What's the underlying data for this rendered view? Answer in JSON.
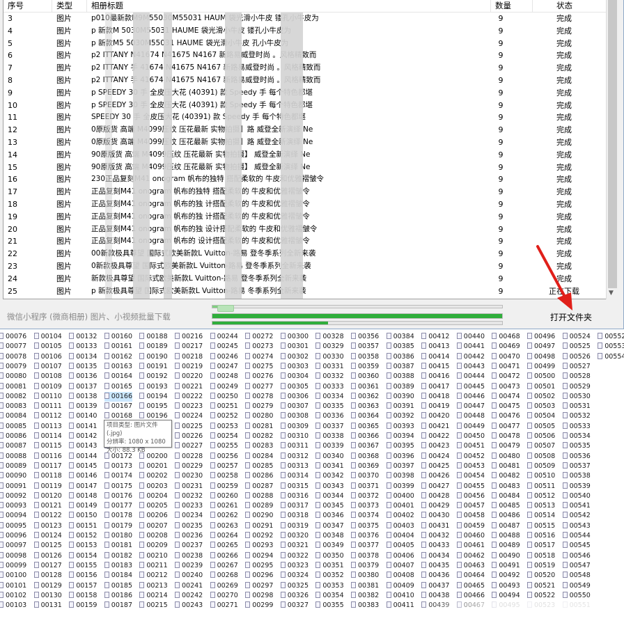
{
  "columns": {
    "num": "序号",
    "type": "类型",
    "title": "相册标题",
    "qty": "数量",
    "status": "状态"
  },
  "rows": [
    {
      "num": "3",
      "type": "图片",
      "title": "p010最新款M9M55030M55031 HAUM 袋光滑小牛皮 镂孔小牛皮为",
      "qty": "9",
      "status": "完成"
    },
    {
      "num": "4",
      "type": "图片",
      "title": "p 新款M 5030M55031 HAUME 袋光滑小牛皮 镂孔小牛皮为",
      "qty": "9",
      "status": "完成"
    },
    {
      "num": "5",
      "type": "图片",
      "title": "p 新款M5 5030M55031 HAUME 袋光滑小牛皮 孔小牛皮为",
      "qty": "9",
      "status": "完成"
    },
    {
      "num": "6",
      "type": "图片",
      "title": "p2 ITTANY N41674 N41675 N4167 新路易威登时尚 。风格精致而",
      "qty": "9",
      "status": "完成"
    },
    {
      "num": "7",
      "type": "图片",
      "title": "p2 ITTANY 手 41674 N41675 N4167 新路易威登时尚 。风格精致而",
      "qty": "9",
      "status": "完成"
    },
    {
      "num": "8",
      "type": "图片",
      "title": "p2 ITTANY 手 41674 N41675 N4167 新路易威登时尚 。风格精致而",
      "qty": "9",
      "status": "完成"
    },
    {
      "num": "9",
      "type": "图片",
      "title": "p SPEEDY 30 手 全皮压大花 (40391) 款 Speedy 手 每个特色都堪",
      "qty": "9",
      "status": "完成"
    },
    {
      "num": "10",
      "type": "图片",
      "title": "p SPEEDY 30 手 全皮压大花 (40391) 款 Speedy 手 每个特色都堪",
      "qty": "9",
      "status": "完成"
    },
    {
      "num": "11",
      "type": "图片",
      "title": "SPEEDY 30 手 全皮压大花 (40391) 款 Speedy 手 每个特色都堪",
      "qty": "9",
      "status": "完成"
    },
    {
      "num": "12",
      "type": "图片",
      "title": "0原版货 高端 M4099压纹 压花最新 实物拍摄】路 威登全新演绎 Ne",
      "qty": "9",
      "status": "完成"
    },
    {
      "num": "13",
      "type": "图片",
      "title": "0原版货 高端 M4099压纹 压花最新 实物拍摄】路 威登全新演绎 Ne",
      "qty": "9",
      "status": "完成"
    },
    {
      "num": "14",
      "type": "图片",
      "title": "90原版货 高端 M4099压纹 压花最新 实物拍摄】 威登全新演绎 Ne",
      "qty": "9",
      "status": "完成"
    },
    {
      "num": "15",
      "type": "图片",
      "title": "90原版货 高端 M4099压纹 压花最新 实物拍摄】 威登全新演绎 Ne",
      "qty": "9",
      "status": "完成"
    },
    {
      "num": "16",
      "type": "图片",
      "title": "230正品复刻M41 onogram 帆布的独特 搭配柔软的 牛皮和优雅褶皱令",
      "qty": "9",
      "status": "完成"
    },
    {
      "num": "17",
      "type": "图片",
      "title": "正品复刻M41 onogram 帆布的独特 搭配柔软的 牛皮和优雅褶皱令",
      "qty": "9",
      "status": "完成"
    },
    {
      "num": "18",
      "type": "图片",
      "title": "正品复刻M41 onogram 帆布的独 计搭配柔软的 牛皮和优雅褶皱令",
      "qty": "9",
      "status": "完成"
    },
    {
      "num": "19",
      "type": "图片",
      "title": "正品复刻M41 onogram 帆布的独 计搭配柔软的 牛皮和优雅褶皱令",
      "qty": "9",
      "status": "完成"
    },
    {
      "num": "20",
      "type": "图片",
      "title": "正品复刻M41 onogram 帆布的独 设计搭配柔软的 牛皮和优雅褶皱令",
      "qty": "9",
      "status": "完成"
    },
    {
      "num": "21",
      "type": "图片",
      "title": "正品复刻M41 onogram 帆布的 设计搭配柔软的 牛皮和优雅褶皱令",
      "qty": "9",
      "status": "完成"
    },
    {
      "num": "22",
      "type": "图片",
      "title": "00新款极具尊望 国际式欧美新款L Vuitton-路易 登冬季系列全新来袭",
      "qty": "9",
      "status": "完成"
    },
    {
      "num": "23",
      "type": "图片",
      "title": "0新款极具尊望 国际式欧美新款L Vuitton-路易 登冬季系列全新来袭",
      "qty": "9",
      "status": "完成"
    },
    {
      "num": "24",
      "type": "图片",
      "title": "新款极具尊望 国际式欧美新款L Vuitton-路易 登冬季系列全新来袭",
      "qty": "9",
      "status": "完成"
    },
    {
      "num": "25",
      "type": "图片",
      "title": "p 新款极具尊望 国际式欧美新款L Vuitton-路易 冬季系列全新来袭",
      "qty": "9",
      "status": "正在下载"
    }
  ],
  "bottom": {
    "hint": "微信小程序 (微商相册) 图片、小视频批量下载",
    "open_folder_label": "打开文件夹",
    "progress_top": 0.05,
    "progress_middle": 1.0,
    "progress_bottom": 0.4
  },
  "tooltip": {
    "line1": "项目类型: 图片文件(.jpg)",
    "line2": "分辨率: 1080 x 1080",
    "line3": "大小: 88.3 KB"
  },
  "files": {
    "columns": [
      [
        "00076",
        "00077",
        "00078",
        "00079",
        "00080",
        "00081",
        "00082",
        "00083",
        "00084",
        "00085",
        "00086",
        "00087",
        "00088",
        "00089",
        "00090",
        "00091",
        "00092",
        "00093",
        "00094",
        "00095",
        "00096",
        "00097",
        "00098",
        "00099",
        "00100",
        "00101",
        "00102",
        "00103"
      ],
      [
        "00104",
        "00105",
        "00106",
        "00107",
        "00108",
        "00109",
        "00110",
        "00111",
        "00112",
        "00113",
        "00114",
        "00115",
        "00116",
        "00117",
        "00118",
        "00119",
        "00120",
        "00121",
        "00122",
        "00123",
        "00124",
        "00125",
        "00126",
        "00127",
        "00128",
        "00129",
        "00130",
        "00131"
      ],
      [
        "00132",
        "00133",
        "00134",
        "00135",
        "00136",
        "00137",
        "00138",
        "00139",
        "00140",
        "00141",
        "00142",
        "00143",
        "00144",
        "00145",
        "00146",
        "00147",
        "00148",
        "00149",
        "00150",
        "00151",
        "00152",
        "00153",
        "00154",
        "00155",
        "00156",
        "00157",
        "00158",
        "00159"
      ],
      [
        "00160",
        "00161",
        "00162",
        "00163",
        "00164",
        "00165",
        "00166",
        "00167",
        "00168",
        "00169",
        "00170",
        "00171",
        "00172",
        "00173",
        "00174",
        "00175",
        "00176",
        "00177",
        "00178",
        "00179",
        "00180",
        "00181",
        "00182",
        "00183",
        "00184",
        "00185",
        "00186",
        "00187"
      ],
      [
        "00188",
        "00189",
        "00190",
        "00191",
        "00192",
        "00193",
        "00194",
        "00195",
        "00196",
        "00197",
        "00198",
        "00199",
        "00200",
        "00201",
        "00202",
        "00203",
        "00204",
        "00205",
        "00206",
        "00207",
        "00208",
        "00209",
        "00210",
        "00211",
        "00212",
        "00213",
        "00214",
        "00215"
      ],
      [
        "00216",
        "00217",
        "00218",
        "00219",
        "00220",
        "00221",
        "00222",
        "00223",
        "00224",
        "00225",
        "00226",
        "00227",
        "00228",
        "00229",
        "00230",
        "00231",
        "00232",
        "00233",
        "00234",
        "00235",
        "00236",
        "00237",
        "00238",
        "00239",
        "00240",
        "00241",
        "00242",
        "00243"
      ],
      [
        "00244",
        "00245",
        "00246",
        "00247",
        "00248",
        "00249",
        "00250",
        "00251",
        "00252",
        "00253",
        "00254",
        "00255",
        "00256",
        "00257",
        "00258",
        "00259",
        "00260",
        "00261",
        "00262",
        "00263",
        "00264",
        "00265",
        "00266",
        "00267",
        "00268",
        "00269",
        "00270",
        "00271"
      ],
      [
        "00272",
        "00273",
        "00274",
        "00275",
        "00276",
        "00277",
        "00278",
        "00279",
        "00280",
        "00281",
        "00282",
        "00283",
        "00284",
        "00285",
        "00286",
        "00287",
        "00288",
        "00289",
        "00290",
        "00291",
        "00292",
        "00293",
        "00294",
        "00295",
        "00296",
        "00297",
        "00298",
        "00299"
      ],
      [
        "00300",
        "00301",
        "00302",
        "00303",
        "00304",
        "00305",
        "00306",
        "00307",
        "00308",
        "00309",
        "00310",
        "00311",
        "00312",
        "00313",
        "00314",
        "00315",
        "00316",
        "00317",
        "00318",
        "00319",
        "00320",
        "00321",
        "00322",
        "00323",
        "00324",
        "00325",
        "00326",
        "00327"
      ],
      [
        "00328",
        "00329",
        "00330",
        "00331",
        "00332",
        "00333",
        "00334",
        "00335",
        "00336",
        "00337",
        "00338",
        "00339",
        "00340",
        "00341",
        "00342",
        "00343",
        "00344",
        "00345",
        "00346",
        "00347",
        "00348",
        "00349",
        "00350",
        "00351",
        "00352",
        "00353",
        "00354",
        "00355"
      ],
      [
        "00356",
        "00357",
        "00358",
        "00359",
        "00360",
        "00361",
        "00362",
        "00363",
        "00364",
        "00365",
        "00366",
        "00367",
        "00368",
        "00369",
        "00370",
        "00371",
        "00372",
        "00373",
        "00374",
        "00375",
        "00376",
        "00377",
        "00378",
        "00379",
        "00380",
        "00381",
        "00382",
        "00383"
      ],
      [
        "00384",
        "00385",
        "00386",
        "00387",
        "00388",
        "00389",
        "00390",
        "00391",
        "00392",
        "00393",
        "00394",
        "00395",
        "00396",
        "00397",
        "00398",
        "00399",
        "00400",
        "00401",
        "00402",
        "00403",
        "00404",
        "00405",
        "00406",
        "00407",
        "00408",
        "00409",
        "00410",
        "00411"
      ],
      [
        "00412",
        "00413",
        "00414",
        "00415",
        "00416",
        "00417",
        "00418",
        "00419",
        "00420",
        "00421",
        "00422",
        "00423",
        "00424",
        "00425",
        "00426",
        "00427",
        "00428",
        "00429",
        "00430",
        "00431",
        "00432",
        "00433",
        "00434",
        "00435",
        "00436",
        "00437",
        "00438",
        "00439"
      ],
      [
        "00440",
        "00441",
        "00442",
        "00443",
        "00444",
        "00445",
        "00446",
        "00447",
        "00448",
        "00449",
        "00450",
        "00451",
        "00452",
        "00453",
        "00454",
        "00455",
        "00456",
        "00457",
        "00458",
        "00459",
        "00460",
        "00461",
        "00462",
        "00463",
        "00464",
        "00465",
        "00466",
        "00467"
      ],
      [
        "00468",
        "00469",
        "00470",
        "00471",
        "00472",
        "00473",
        "00474",
        "00475",
        "00476",
        "00477",
        "00478",
        "00479",
        "00480",
        "00481",
        "00482",
        "00483",
        "00484",
        "00485",
        "00486",
        "00487",
        "00488",
        "00489",
        "00490",
        "00491",
        "00492",
        "00493",
        "00494",
        "00495"
      ],
      [
        "00496",
        "00497",
        "00498",
        "00499",
        "00500",
        "00501",
        "00502",
        "00503",
        "00504",
        "00505",
        "00506",
        "00507",
        "00508",
        "00509",
        "00510",
        "00511",
        "00512",
        "00513",
        "00514",
        "00515",
        "00516",
        "00517",
        "00518",
        "00519",
        "00520",
        "00521",
        "00522",
        "00523"
      ],
      [
        "00524",
        "00525",
        "00526",
        "00527",
        "00528",
        "00529",
        "00530",
        "00531",
        "00532",
        "00533",
        "00534",
        "00535",
        "00536",
        "00537",
        "00538",
        "00539",
        "00540",
        "00541",
        "00542",
        "00543",
        "00544",
        "00545",
        "00546",
        "00547",
        "00548",
        "00549",
        "00550",
        "00551"
      ],
      [
        "00552",
        "00553",
        "00554"
      ]
    ],
    "selected": "00166"
  }
}
